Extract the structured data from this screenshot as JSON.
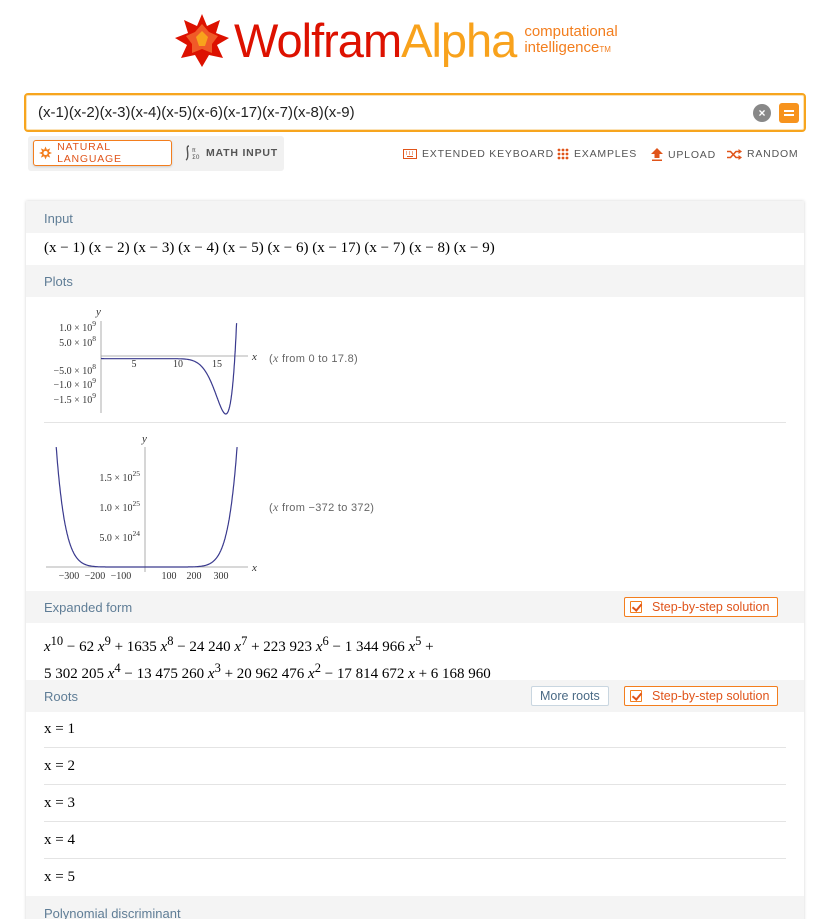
{
  "logo": {
    "wordmark_1": "Wolfram",
    "wordmark_2": "Alpha",
    "tagline_1": "computational",
    "tagline_2": "intelligence",
    "trademark": "TM",
    "colors": {
      "red": "#dd1100",
      "gold": "#f8a21c",
      "orange": "#f37e1e"
    }
  },
  "search": {
    "value": "(x-1)(x-2)(x-3)(x-4)(x-5)(x-6)(x-17)(x-7)(x-8)(x-9)",
    "clear_icon": "close-icon",
    "submit_icon": "equals-icon"
  },
  "toolbar": {
    "natural_language": "NATURAL LANGUAGE",
    "math_input": "MATH INPUT",
    "extended_keyboard": "EXTENDED KEYBOARD",
    "examples": "EXAMPLES",
    "upload": "UPLOAD",
    "random": "RANDOM"
  },
  "pods": {
    "input": {
      "title": "Input",
      "expression": "(x − 1) (x − 2) (x − 3) (x − 4) (x − 5) (x − 6) (x − 17) (x − 7) (x − 8) (x − 9)"
    },
    "plots": {
      "title": "Plots",
      "plot1_range": "from 0 to 17.8",
      "plot2_range": "from −372 to 372",
      "range_var": "x"
    },
    "expanded": {
      "title": "Expanded form",
      "step_button": "Step-by-step solution"
    },
    "roots": {
      "title": "Roots",
      "more_button": "More roots",
      "step_button": "Step-by-step solution",
      "items": [
        "x = 1",
        "x = 2",
        "x = 3",
        "x = 4",
        "x = 5"
      ]
    },
    "discriminant": {
      "title": "Polynomial discriminant"
    }
  },
  "chart_data": [
    {
      "type": "line",
      "function": "(x-1)(x-2)(x-3)(x-4)(x-5)(x-6)(x-17)(x-7)(x-8)(x-9)",
      "xlabel": "x",
      "ylabel": "y",
      "xlim": [
        0,
        17.8
      ],
      "ylim": [
        -1800000000.0,
        1250000000.0
      ],
      "x_ticks": [
        "5",
        "10",
        "15"
      ],
      "y_ticks": [
        "1.0×10^9",
        "5.0×10^8",
        "−5.0×10^8",
        "−1.0×10^9",
        "−1.5×10^9"
      ],
      "grid": false
    },
    {
      "type": "line",
      "function": "(x-1)(x-2)(x-3)(x-4)(x-5)(x-6)(x-17)(x-7)(x-8)(x-9)",
      "xlabel": "x",
      "ylabel": "y",
      "xlim": [
        -372,
        372
      ],
      "ylim": [
        0,
        2.05e+25
      ],
      "x_ticks": [
        "−300",
        "−200",
        "−100",
        "100",
        "200",
        "300"
      ],
      "y_ticks": [
        "1.5×10^25",
        "1.0×10^25",
        "5.0×10^24"
      ],
      "grid": false
    }
  ]
}
